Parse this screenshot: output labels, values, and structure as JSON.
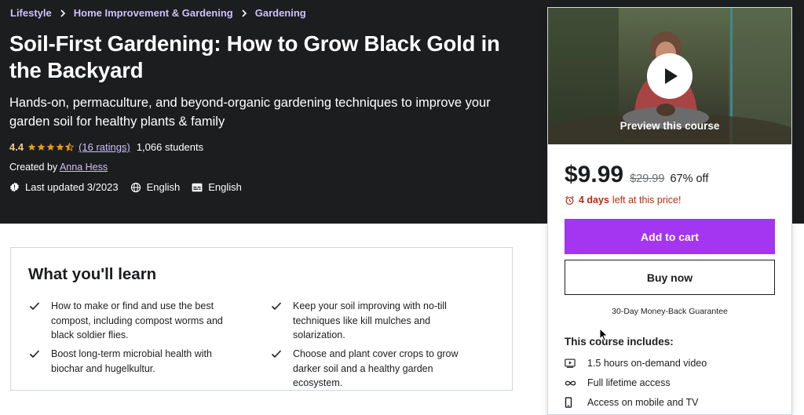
{
  "breadcrumb": [
    "Lifestyle",
    "Home Improvement & Gardening",
    "Gardening"
  ],
  "course": {
    "title": "Soil-First Gardening: How to Grow Black Gold in the Backyard",
    "subtitle": "Hands-on, permaculture, and beyond-organic gardening techniques to improve your garden soil for healthy plants & family",
    "rating": "4.4",
    "rating_value": 4.4,
    "ratings_link": "(16 ratings)",
    "students": "1,066 students",
    "created_by_label": "Created by",
    "author": "Anna Hess",
    "last_updated": "Last updated 3/2023",
    "language": "English",
    "captions": "English"
  },
  "learn": {
    "title": "What you'll learn",
    "items": [
      "How to make or find and use the best compost, including compost worms and black soldier flies.",
      "Keep your soil improving with no-till techniques like kill mulches and solarization.",
      "Boost long-term microbial health with biochar and hugelkultur.",
      "Choose and plant cover crops to grow darker soil and a healthy garden ecosystem."
    ]
  },
  "sidebar": {
    "preview_label": "Preview this course",
    "price": "$9.99",
    "old_price": "$29.99",
    "discount": "67% off",
    "timer_days": "4 days",
    "timer_rest": "left at this price!",
    "add_to_cart": "Add to cart",
    "buy_now": "Buy now",
    "guarantee": "30-Day Money-Back Guarantee",
    "includes_title": "This course includes:",
    "includes": [
      {
        "icon": "video-icon",
        "label": "1.5 hours on-demand video"
      },
      {
        "icon": "infinity-icon",
        "label": "Full lifetime access"
      },
      {
        "icon": "mobile-icon",
        "label": "Access on mobile and TV"
      }
    ]
  },
  "colors": {
    "hero_bg": "#1c1d1f",
    "accent_purple": "#a435f0",
    "link_purple": "#cec0fc",
    "star_gold": "#f3ca8c",
    "timer_red": "#b32d0f"
  }
}
